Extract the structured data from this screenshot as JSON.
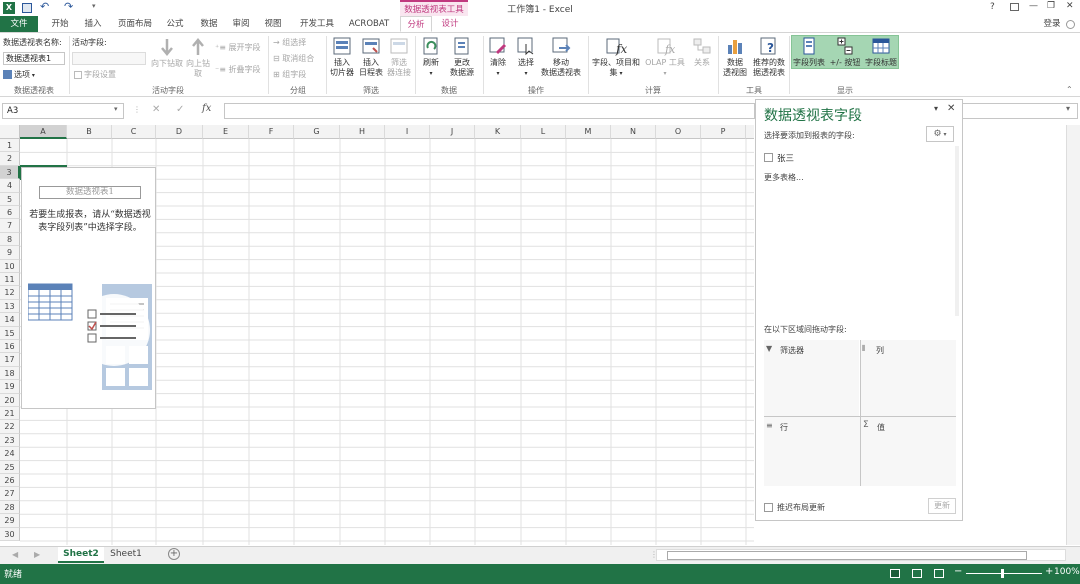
{
  "titlebar": {
    "title": "工作簿1 - Excel",
    "context_tab_group": "数据透视表工具",
    "help": "?",
    "minimize": "—",
    "restore": "❐",
    "close": "✕",
    "login": "登录"
  },
  "tabs": {
    "file": "文件",
    "home": "开始",
    "insert": "插入",
    "layout": "页面布局",
    "formulas": "公式",
    "data": "数据",
    "review": "审阅",
    "view": "视图",
    "dev": "开发工具",
    "acrobat": "ACROBAT",
    "analyze": "分析",
    "design": "设计"
  },
  "ribbon": {
    "pivot_name_label": "数据透视表名称:",
    "pivot_name_value": "数据透视表1",
    "options": "选项",
    "active_field_label": "活动字段:",
    "field_settings": "字段设置",
    "drill_down": "向下钻取",
    "drill_up": "向上钻",
    "drill_up2": "取",
    "expand_field": "展开字段",
    "collapse_field": "折叠字段",
    "group_selection": "组选择",
    "ungroup": "取消组合",
    "group_field": "组字段",
    "insert_slicer1": "插入",
    "insert_slicer2": "切片器",
    "insert_timeline1": "插入",
    "insert_timeline2": "日程表",
    "filter_conn1": "筛选",
    "filter_conn2": "器连接",
    "refresh": "刷新",
    "change_source1": "更改",
    "change_source2": "数据源",
    "clear": "清除",
    "select": "选择",
    "move1": "移动",
    "move2": "数据透视表",
    "fields_items1": "字段、项目和",
    "fields_items2": "集",
    "olap": "OLAP 工具",
    "relations": "关系",
    "pivot_chart1": "数据",
    "pivot_chart2": "透视图",
    "recommended1": "推荐的数",
    "recommended2": "据透视表",
    "field_list": "字段列表",
    "buttons": "+/- 按钮",
    "field_headers": "字段标题",
    "groups": {
      "pivot": "数据透视表",
      "active_field": "活动字段",
      "group": "分组",
      "filter": "筛选",
      "data": "数据",
      "actions": "操作",
      "calc": "计算",
      "tools": "工具",
      "show": "显示"
    }
  },
  "formula_bar": {
    "name_box": "A3",
    "fx": "fx"
  },
  "grid": {
    "columns": [
      "A",
      "B",
      "C",
      "D",
      "E",
      "F",
      "G",
      "H",
      "I",
      "J",
      "K",
      "L",
      "M",
      "N",
      "O",
      "P",
      "Q",
      "R",
      "S",
      "T",
      "U",
      "V",
      "W"
    ],
    "rows": [
      "1",
      "2",
      "3",
      "4",
      "5",
      "6",
      "7",
      "8",
      "9",
      "10",
      "11",
      "12",
      "13",
      "14",
      "15",
      "16",
      "17",
      "18",
      "19",
      "20",
      "21",
      "22",
      "23",
      "24",
      "25",
      "26",
      "27",
      "28",
      "29",
      "30"
    ],
    "placeholder_title": "数据透视表1",
    "placeholder_text": "若要生成报表，请从“数据透视表字段列表”中选择字段。"
  },
  "pane": {
    "title": "数据透视表字段",
    "choose_label": "选择要添加到报表的字段:",
    "field1": "张三",
    "more_tables": "更多表格...",
    "drag_label": "在以下区域间拖动字段:",
    "filters": "筛选器",
    "columns": "列",
    "rows": "行",
    "values": "值",
    "defer": "推迟布局更新",
    "update": "更新"
  },
  "sheets": {
    "tabs": [
      "Sheet2",
      "Sheet1"
    ],
    "active": "Sheet2",
    "add": "+"
  },
  "status": {
    "ready": "就绪",
    "zoom": "100%"
  },
  "colors": {
    "excel_green": "#217346",
    "pivot_accent": "#b6c9e0",
    "context_pink": "#c0397f"
  }
}
